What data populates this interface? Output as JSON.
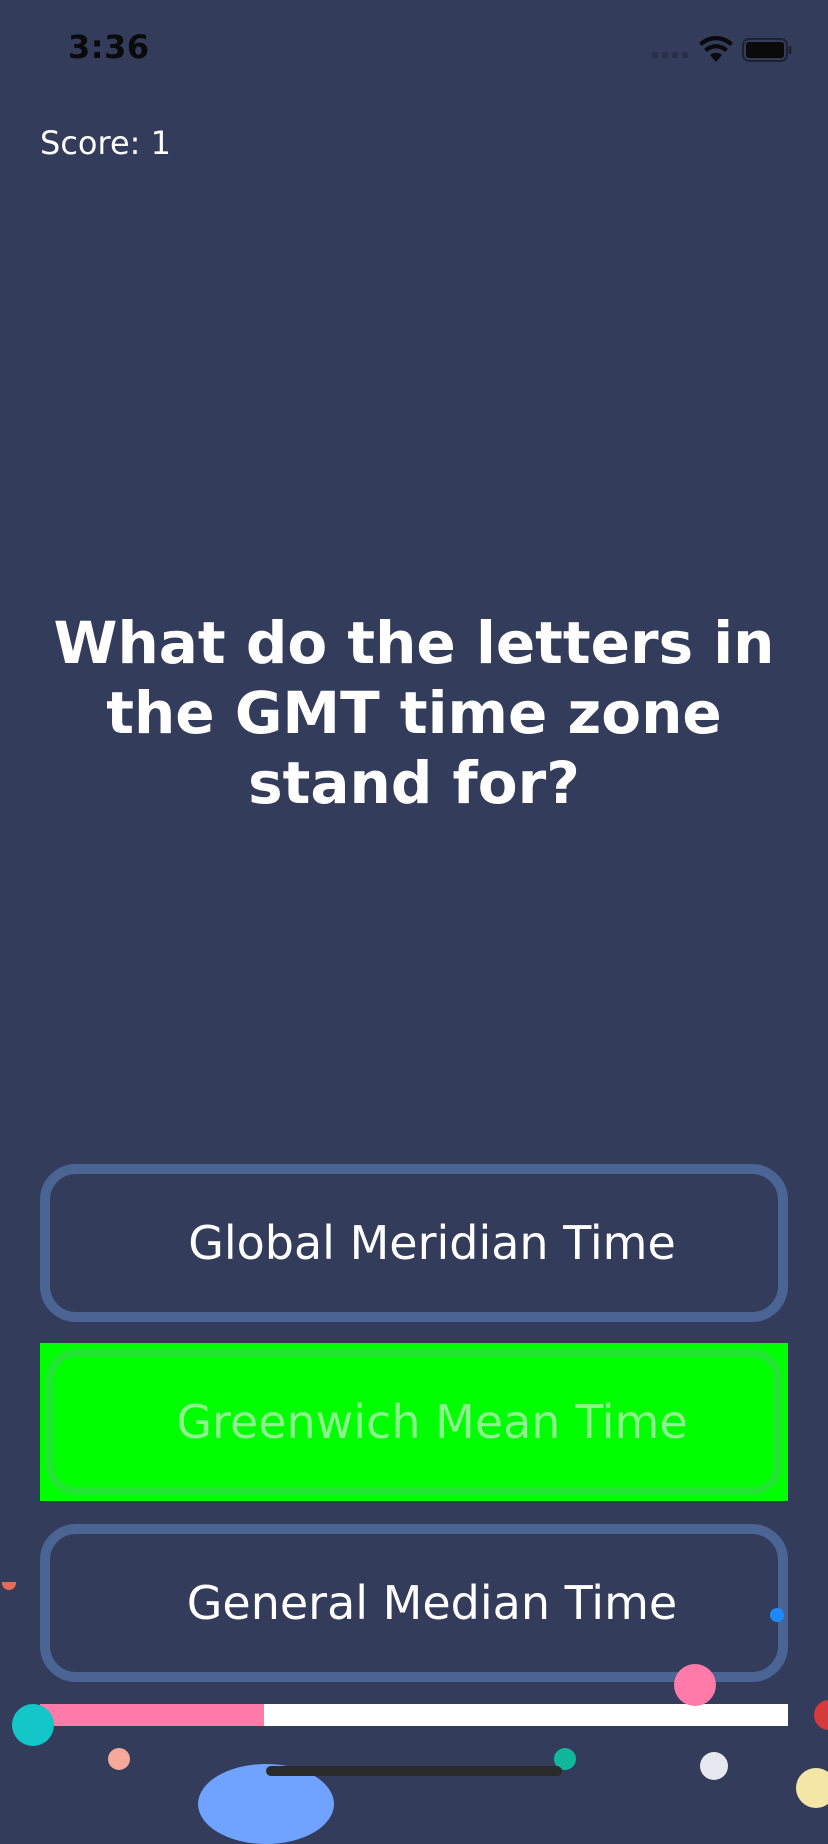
{
  "status_bar": {
    "time": "3:36"
  },
  "game": {
    "score_text": "Score: 1",
    "question": "What do the letters in the GMT time zone stand for?",
    "answers": [
      {
        "label": "Global Meridian Time",
        "state": "default"
      },
      {
        "label": "Greenwich Mean Time",
        "state": "correct"
      },
      {
        "label": "General Median Time",
        "state": "default"
      }
    ],
    "progress": 0.3
  },
  "colors": {
    "background": "#333c5b",
    "answer_border": "#4a6494",
    "correct_fill": "#00ff00",
    "progress_fill": "#ff7aa8",
    "progress_track": "#ffffff"
  }
}
